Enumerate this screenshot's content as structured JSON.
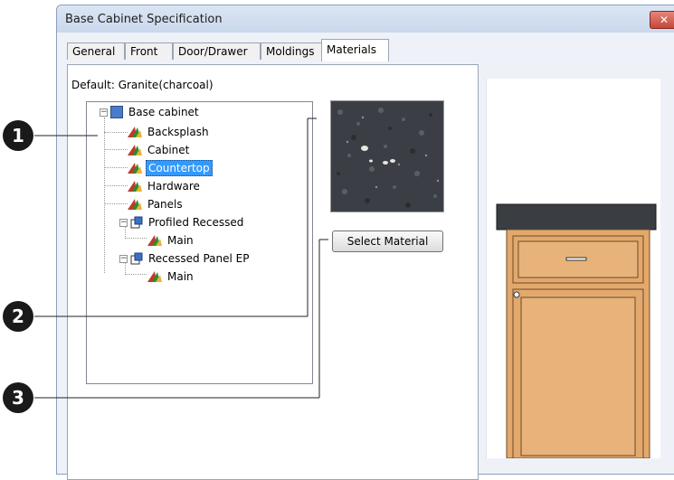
{
  "window": {
    "title": "Base Cabinet Specification",
    "close_label": "✕"
  },
  "tabs": [
    "General",
    "Front",
    "Door/Drawer",
    "Moldings",
    "Materials"
  ],
  "default_text": "Default: Granite(charcoal)",
  "tree": {
    "root": "Base cabinet",
    "items": [
      "Backsplash",
      "Cabinet",
      "Countertop",
      "Hardware",
      "Panels"
    ],
    "group1": {
      "label": "Profiled Recessed",
      "child": "Main"
    },
    "group2": {
      "label": "Recessed Panel EP",
      "child": "Main"
    }
  },
  "buttons": {
    "select_material": "Select Material"
  },
  "callouts": [
    "1",
    "2",
    "3"
  ],
  "colors": {
    "countertop": "#3a3d42",
    "cabinet_face": "#e3a86c",
    "selection": "#3399ff"
  }
}
